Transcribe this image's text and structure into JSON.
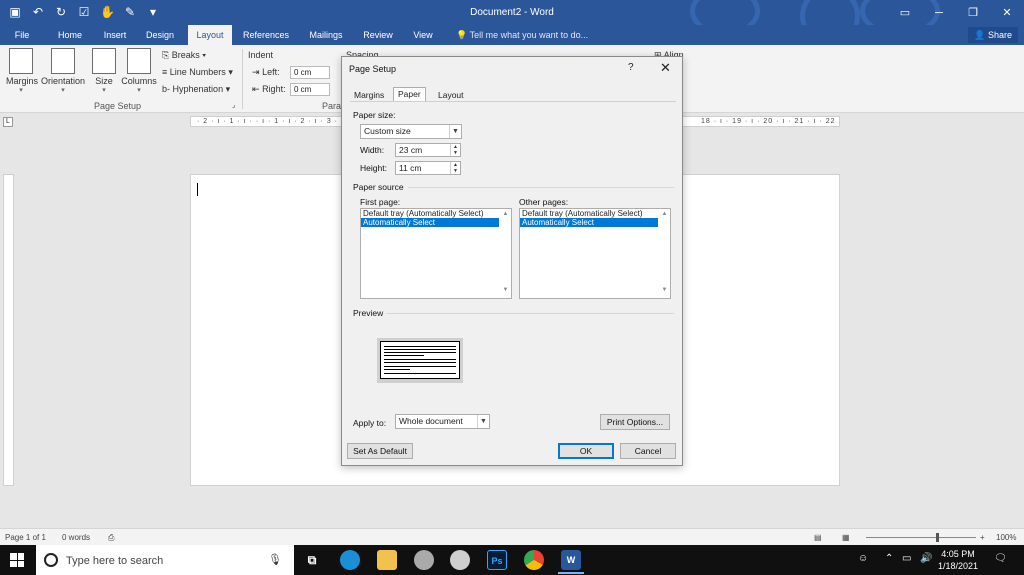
{
  "title_bar": {
    "title": "Document2 - Word",
    "qat_icons": [
      "save-icon",
      "undo-icon",
      "redo-icon",
      "form-icon",
      "touch-mode-icon",
      "pen-icon",
      "customize-icon"
    ]
  },
  "tabs": [
    "File",
    "Home",
    "Insert",
    "Design",
    "Layout",
    "References",
    "Mailings",
    "Review",
    "View"
  ],
  "active_tab": "Layout",
  "tell_me": "Tell me what you want to do...",
  "share": "Share",
  "ribbon": {
    "margins": "Margins",
    "orientation": "Orientation",
    "size": "Size",
    "columns": "Columns",
    "breaks": "Breaks",
    "line_numbers": "Line Numbers",
    "hyphenation": "Hyphenation",
    "page_setup_group": "Page Setup",
    "indent": "Indent",
    "left_label": "Left:",
    "left_value": "0 cm",
    "right_label": "Right:",
    "right_value": "0 cm",
    "spacing": "Spacing",
    "paragraph_partial": "Para",
    "align": "Align"
  },
  "ruler": {
    "corner": "L",
    "marks_left": "· 2 · ı · 1 · ı ·   · ı · 1 · ı · 2 · ı · 3 · ı · 4 · ı · 5 · ı · 6",
    "marks_right": "18 · ı · 19 · ı · 20 · ı · 21 · ı · 22 ·"
  },
  "dialog": {
    "title": "Page Setup",
    "help": "?",
    "tabs": [
      "Margins",
      "Paper",
      "Layout"
    ],
    "active_tab": "Paper",
    "paper_size_label": "Paper size:",
    "paper_size_value": "Custom size",
    "width_label": "Width:",
    "width_value": "23 cm",
    "height_label": "Height:",
    "height_value": "11 cm",
    "paper_source_label": "Paper source",
    "first_page_label": "First page:",
    "other_pages_label": "Other pages:",
    "first_page_options": [
      "Default tray (Automatically Select)",
      "Automatically Select"
    ],
    "other_pages_options": [
      "Default tray (Automatically Select)",
      "Automatically Select"
    ],
    "selected_option": "Automatically Select",
    "preview_label": "Preview",
    "apply_to_label": "Apply to:",
    "apply_to_value": "Whole document",
    "print_options": "Print Options...",
    "set_as_default": "Set As Default",
    "ok": "OK",
    "cancel": "Cancel"
  },
  "status_bar": {
    "page": "Page 1 of 1",
    "words": "0 words",
    "zoom": "100%"
  },
  "taskbar": {
    "search_placeholder": "Type here to search",
    "apps": [
      "task-view",
      "edge",
      "file-explorer",
      "app-4",
      "app-5",
      "photoshop",
      "chrome",
      "word"
    ],
    "photoshop_label": "Ps",
    "word_label": "W",
    "time": "4:05 PM",
    "date": "1/18/2021"
  },
  "colors": {
    "word_blue": "#2b579a",
    "selection": "#0078d7"
  }
}
